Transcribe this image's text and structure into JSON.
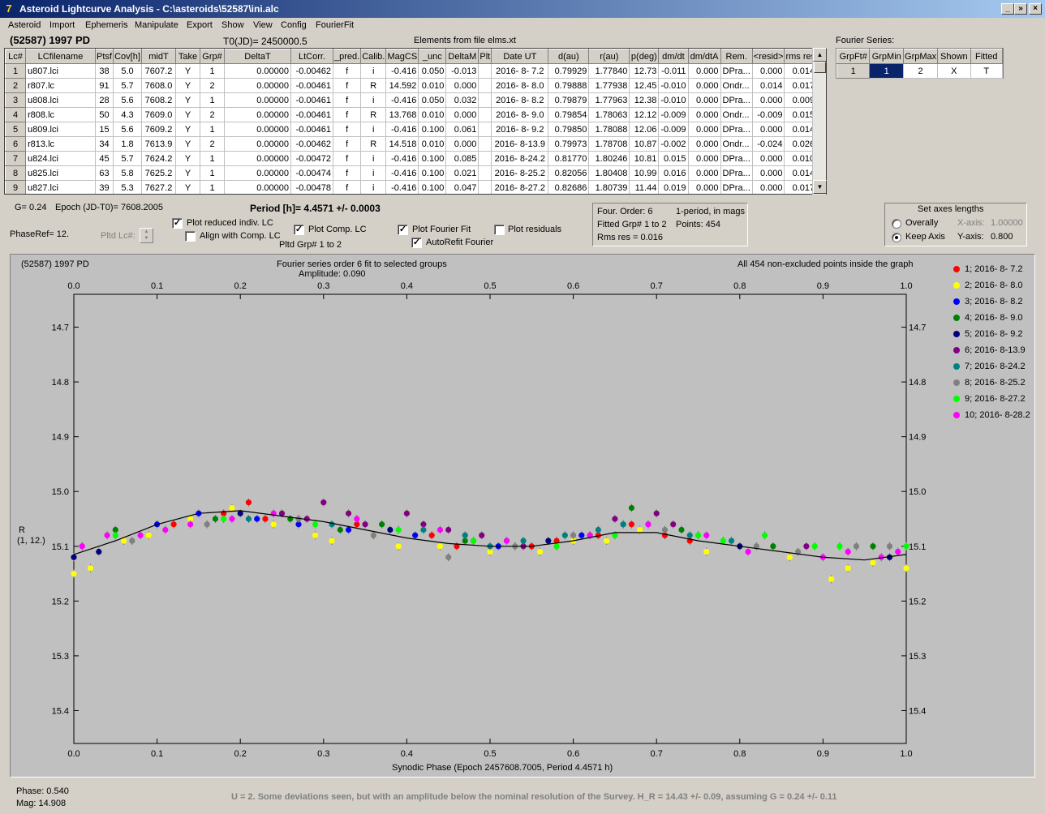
{
  "window": {
    "title": "Asteroid Lightcurve Analysis - C:\\asteroids\\52587\\ini.alc",
    "app_icon": "7",
    "min_label": "_",
    "restore_label": "»",
    "close_label": "×"
  },
  "menu": [
    "Asteroid",
    "Import",
    "Ephemeris",
    "Manipulate",
    "Export",
    "Show",
    "View",
    "Config",
    "FourierFit"
  ],
  "header": {
    "object": "(52587) 1997 PD",
    "t0": "T0(JD)= 2450000.5",
    "elements": "Elements from file elms.xt",
    "fourier_label": "Fourier Series:"
  },
  "lc_table": {
    "columns": [
      "Lc#",
      "LCfilename",
      "Ptsf",
      "Cov[h]",
      "midT",
      "Take",
      "Grp#",
      "DeltaT",
      "LtCorr.",
      "_pred.",
      "Calib.",
      "MagCS",
      "_unc",
      "DeltaM",
      "Plt",
      "Date UT",
      "d(au)",
      "r(au)",
      "p(deg)",
      "dm/dt",
      "dm/dtA",
      "Rem.",
      "<resid>",
      "rms res"
    ],
    "rows": [
      [
        "1",
        "u807.lci",
        "38",
        "5.0",
        "7607.2",
        "Y",
        "1",
        "0.00000",
        "-0.00462",
        "f",
        "i",
        "-0.416",
        "0.050",
        "-0.013",
        "",
        "2016- 8- 7.2",
        "0.79929",
        "1.77840",
        "12.73",
        "-0.011",
        "0.000",
        "DPra...",
        "0.000",
        "0.014"
      ],
      [
        "2",
        "r807.lc",
        "91",
        "5.7",
        "7608.0",
        "Y",
        "2",
        "0.00000",
        "-0.00461",
        "f",
        "R",
        "14.592",
        "0.010",
        "0.000",
        "",
        "2016- 8- 8.0",
        "0.79888",
        "1.77938",
        "12.45",
        "-0.010",
        "0.000",
        "Ondr...",
        "0.014",
        "0.017"
      ],
      [
        "3",
        "u808.lci",
        "28",
        "5.6",
        "7608.2",
        "Y",
        "1",
        "0.00000",
        "-0.00461",
        "f",
        "i",
        "-0.416",
        "0.050",
        "0.032",
        "",
        "2016- 8- 8.2",
        "0.79879",
        "1.77963",
        "12.38",
        "-0.010",
        "0.000",
        "DPra...",
        "0.000",
        "0.009"
      ],
      [
        "4",
        "r808.lc",
        "50",
        "4.3",
        "7609.0",
        "Y",
        "2",
        "0.00000",
        "-0.00461",
        "f",
        "R",
        "13.768",
        "0.010",
        "0.000",
        "",
        "2016- 8- 9.0",
        "0.79854",
        "1.78063",
        "12.12",
        "-0.009",
        "0.000",
        "Ondr...",
        "-0.009",
        "0.015"
      ],
      [
        "5",
        "u809.lci",
        "15",
        "5.6",
        "7609.2",
        "Y",
        "1",
        "0.00000",
        "-0.00461",
        "f",
        "i",
        "-0.416",
        "0.100",
        "0.061",
        "",
        "2016- 8- 9.2",
        "0.79850",
        "1.78088",
        "12.06",
        "-0.009",
        "0.000",
        "DPra...",
        "0.000",
        "0.014"
      ],
      [
        "6",
        "r813.lc",
        "34",
        "1.8",
        "7613.9",
        "Y",
        "2",
        "0.00000",
        "-0.00462",
        "f",
        "R",
        "14.518",
        "0.010",
        "0.000",
        "",
        "2016- 8-13.9",
        "0.79973",
        "1.78708",
        "10.87",
        "-0.002",
        "0.000",
        "Ondr...",
        "-0.024",
        "0.026"
      ],
      [
        "7",
        "u824.lci",
        "45",
        "5.7",
        "7624.2",
        "Y",
        "1",
        "0.00000",
        "-0.00472",
        "f",
        "i",
        "-0.416",
        "0.100",
        "0.085",
        "",
        "2016- 8-24.2",
        "0.81770",
        "1.80246",
        "10.81",
        "0.015",
        "0.000",
        "DPra...",
        "0.000",
        "0.010"
      ],
      [
        "8",
        "u825.lci",
        "63",
        "5.8",
        "7625.2",
        "Y",
        "1",
        "0.00000",
        "-0.00474",
        "f",
        "i",
        "-0.416",
        "0.100",
        "0.021",
        "",
        "2016- 8-25.2",
        "0.82056",
        "1.80408",
        "10.99",
        "0.016",
        "0.000",
        "DPra...",
        "0.000",
        "0.014"
      ],
      [
        "9",
        "u827.lci",
        "39",
        "5.3",
        "7627.2",
        "Y",
        "1",
        "0.00000",
        "-0.00478",
        "f",
        "i",
        "-0.416",
        "0.100",
        "0.047",
        "",
        "2016- 8-27.2",
        "0.82686",
        "1.80739",
        "11.44",
        "0.019",
        "0.000",
        "DPra...",
        "0.000",
        "0.017"
      ]
    ]
  },
  "fourier_table": {
    "columns": [
      "GrpFt#",
      "GrpMin",
      "GrpMax",
      "Shown",
      "Fitted"
    ],
    "row": [
      "1",
      "1",
      "2",
      "X",
      "T"
    ]
  },
  "controls": {
    "g_value": "G= 0.24",
    "epoch": "Epoch (JD-T0)= 7608.2005",
    "period": "Period [h]= 4.4571 +/- 0.0003",
    "phaseref": "PhaseRef= 12.",
    "pltd_lc": "Pltd Lc#:",
    "plot_reduced": "Plot reduced indiv. LC",
    "align_comp": "Align with Comp. LC",
    "plot_comp": "Plot Comp. LC",
    "pltd_grp": "Pltd Grp#  1   to   2",
    "plot_fourier": "Plot Fourier Fit",
    "autorefit": "AutoRefit Fourier",
    "plot_residuals": "Plot residuals",
    "checked_mark": "✓",
    "four_order": "Four. Order:  6",
    "one_period": "1-period, in mags",
    "fitted_grp": "Fitted Grp# 1 to 2",
    "points": "Points: 454",
    "rms_res": "Rms res     = 0.016",
    "axes_title": "Set axes lengths",
    "overally": "Overally",
    "keep_axis": "Keep Axis",
    "x_axis_label": "X-axis:",
    "x_axis_value": "1.00000",
    "y_axis_label": "Y-axis:",
    "y_axis_value": "0.800"
  },
  "plot": {
    "object": "(52587) 1997 PD",
    "fit_title": "Fourier series order 6 fit to selected groups",
    "amplitude": "Amplitude: 0.090",
    "points_note": "All 454 non-excluded points inside the graph",
    "ylabel": "R",
    "ylabel2": "(1, 12.)",
    "xlabel": "Synodic Phase (Epoch 2457608.7005, Period 4.4571 h)"
  },
  "chart_data": {
    "type": "scatter",
    "title": "Fourier series order 6 fit to selected groups",
    "xlabel": "Synodic Phase (Epoch 2457608.7005, Period 4.4571 h)",
    "ylabel": "R (1, 12.)",
    "xlim": [
      0.0,
      1.0
    ],
    "ylim": [
      15.46,
      14.64
    ],
    "x_ticks": [
      "0.0",
      "0.1",
      "0.2",
      "0.3",
      "0.4",
      "0.5",
      "0.6",
      "0.7",
      "0.8",
      "0.9",
      "1.0"
    ],
    "y_ticks": [
      "14.7",
      "14.8",
      "14.9",
      "15.0",
      "15.1",
      "15.2",
      "15.3",
      "15.4"
    ],
    "legend_placement": "right",
    "fit_curve": {
      "x": [
        0.0,
        0.05,
        0.1,
        0.15,
        0.2,
        0.25,
        0.3,
        0.35,
        0.4,
        0.45,
        0.5,
        0.55,
        0.6,
        0.65,
        0.7,
        0.75,
        0.8,
        0.85,
        0.9,
        0.95,
        1.0
      ],
      "y": [
        15.115,
        15.09,
        15.06,
        15.04,
        15.035,
        15.045,
        15.055,
        15.07,
        15.085,
        15.095,
        15.1,
        15.1,
        15.09,
        15.075,
        15.075,
        15.09,
        15.1,
        15.11,
        15.12,
        15.125,
        15.115
      ]
    },
    "series": [
      {
        "name": "1; 2016- 8- 7.2",
        "color": "#ff0000",
        "x": [
          0.12,
          0.18,
          0.21,
          0.23,
          0.34,
          0.43,
          0.46,
          0.48,
          0.55,
          0.58,
          0.63,
          0.67,
          0.71,
          0.74
        ],
        "y": [
          15.06,
          15.04,
          15.02,
          15.05,
          15.06,
          15.08,
          15.1,
          15.09,
          15.1,
          15.09,
          15.08,
          15.06,
          15.08,
          15.09
        ]
      },
      {
        "name": "2; 2016- 8- 8.0",
        "color": "#ffff00",
        "x": [
          0.0,
          0.02,
          0.06,
          0.09,
          0.14,
          0.19,
          0.24,
          0.29,
          0.31,
          0.36,
          0.39,
          0.44,
          0.5,
          0.53,
          0.56,
          0.6,
          0.64,
          0.68,
          0.76,
          0.86,
          0.91,
          0.93,
          0.96,
          1.0
        ],
        "y": [
          15.15,
          15.14,
          15.09,
          15.08,
          15.05,
          15.03,
          15.06,
          15.08,
          15.09,
          15.08,
          15.1,
          15.1,
          15.11,
          15.1,
          15.11,
          15.09,
          15.09,
          15.07,
          15.11,
          15.12,
          15.16,
          15.14,
          15.13,
          15.14
        ]
      },
      {
        "name": "3; 2016- 8- 8.2",
        "color": "#0000ff",
        "x": [
          0.1,
          0.15,
          0.22,
          0.27,
          0.33,
          0.41,
          0.51,
          0.61
        ],
        "y": [
          15.06,
          15.04,
          15.05,
          15.06,
          15.07,
          15.08,
          15.1,
          15.08
        ]
      },
      {
        "name": "4; 2016- 8- 9.0",
        "color": "#008000",
        "x": [
          0.05,
          0.17,
          0.26,
          0.32,
          0.37,
          0.47,
          0.52,
          0.62,
          0.66,
          0.67,
          0.73,
          0.84,
          0.96
        ],
        "y": [
          15.07,
          15.05,
          15.05,
          15.07,
          15.06,
          15.09,
          15.09,
          15.08,
          15.06,
          15.03,
          15.07,
          15.1,
          15.1
        ]
      },
      {
        "name": "5; 2016- 8- 9.2",
        "color": "#000080",
        "x": [
          0.0,
          0.03,
          0.2,
          0.38,
          0.57,
          0.8,
          0.98
        ],
        "y": [
          15.12,
          15.11,
          15.04,
          15.07,
          15.09,
          15.1,
          15.12
        ]
      },
      {
        "name": "6; 2016- 8-13.9",
        "color": "#800080",
        "x": [
          0.25,
          0.28,
          0.3,
          0.33,
          0.35,
          0.4,
          0.42,
          0.45,
          0.49,
          0.54,
          0.65,
          0.7,
          0.72,
          0.88
        ],
        "y": [
          15.04,
          15.05,
          15.02,
          15.04,
          15.06,
          15.04,
          15.06,
          15.07,
          15.08,
          15.1,
          15.05,
          15.04,
          15.06,
          15.1
        ]
      },
      {
        "name": "7; 2016- 8-24.2",
        "color": "#008080",
        "x": [
          0.21,
          0.31,
          0.42,
          0.47,
          0.5,
          0.54,
          0.59,
          0.63,
          0.66,
          0.69,
          0.74,
          0.79
        ],
        "y": [
          15.05,
          15.06,
          15.07,
          15.08,
          15.1,
          15.09,
          15.08,
          15.07,
          15.06,
          15.06,
          15.08,
          15.09
        ]
      },
      {
        "name": "8; 2016- 8-25.2",
        "color": "#808080",
        "x": [
          0.01,
          0.07,
          0.16,
          0.27,
          0.36,
          0.45,
          0.53,
          0.6,
          0.71,
          0.75,
          0.82,
          0.87,
          0.94,
          0.98
        ],
        "y": [
          15.1,
          15.09,
          15.06,
          15.05,
          15.08,
          15.12,
          15.1,
          15.08,
          15.07,
          15.08,
          15.1,
          15.11,
          15.1,
          15.1
        ]
      },
      {
        "name": "9; 2016- 8-27.2",
        "color": "#00ff00",
        "x": [
          0.05,
          0.18,
          0.29,
          0.39,
          0.48,
          0.58,
          0.65,
          0.75,
          0.78,
          0.83,
          0.89,
          0.92,
          1.0
        ],
        "y": [
          15.08,
          15.05,
          15.06,
          15.07,
          15.09,
          15.1,
          15.08,
          15.08,
          15.09,
          15.08,
          15.1,
          15.1,
          15.1
        ]
      },
      {
        "name": "10; 2016- 8-28.2",
        "color": "#ff00ff",
        "x": [
          0.01,
          0.04,
          0.08,
          0.11,
          0.14,
          0.19,
          0.24,
          0.34,
          0.44,
          0.52,
          0.62,
          0.69,
          0.76,
          0.81,
          0.9,
          0.93,
          0.97,
          0.99
        ],
        "y": [
          15.1,
          15.08,
          15.08,
          15.07,
          15.06,
          15.05,
          15.04,
          15.05,
          15.07,
          15.09,
          15.08,
          15.06,
          15.08,
          15.11,
          15.12,
          15.11,
          15.12,
          15.11
        ]
      }
    ]
  },
  "status": {
    "phase": "Phase:  0.540",
    "mag": "Mag:    14.908",
    "message": "U = 2.  Some deviations seen, but with an amplitude below the nominal resolution of the Survey.  H_R = 14.43 +/- 0.09, assuming G = 0.24 +/- 0.11"
  }
}
